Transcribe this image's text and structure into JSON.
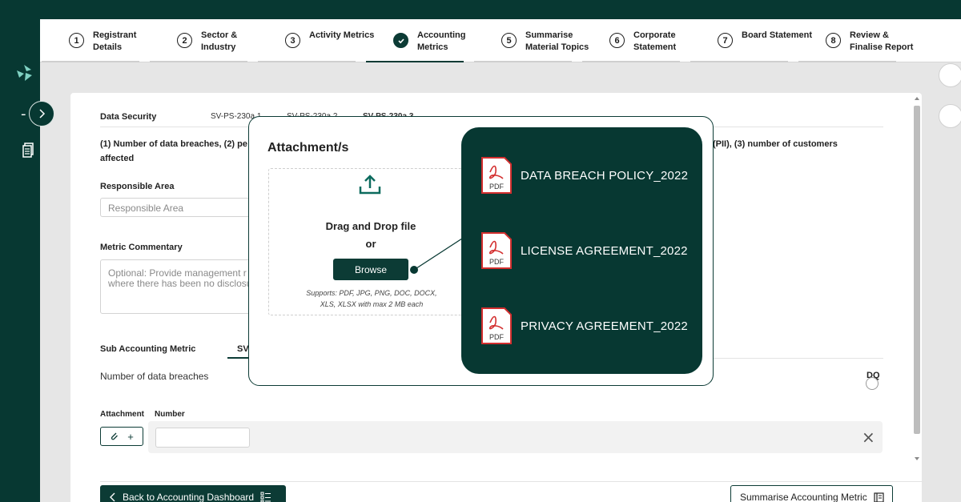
{
  "stepper": [
    {
      "num": "1",
      "label": "Registrant Details",
      "state": "pending"
    },
    {
      "num": "2",
      "label": "Sector & Industry",
      "state": "pending"
    },
    {
      "num": "3",
      "label": "Activity Metrics",
      "state": "pending"
    },
    {
      "num": "",
      "label": "Accounting Metrics",
      "state": "active"
    },
    {
      "num": "5",
      "label": "Summarise Material Topics",
      "state": "pending"
    },
    {
      "num": "6",
      "label": "Corporate Statement",
      "state": "pending"
    },
    {
      "num": "7",
      "label": "Board Statement",
      "state": "pending"
    },
    {
      "num": "8",
      "label": "Review & Finalise Report",
      "state": "pending"
    }
  ],
  "metric": {
    "topic": "Data Security",
    "codes": [
      "SV-PS-230a.1",
      "SV-PS-230a.2",
      "SV-PS-230a.3"
    ],
    "description_left": "(1) Number of data breaches, (2) pe",
    "description_right": "(PII), (3) number of customers",
    "description_line2": "affected"
  },
  "form": {
    "responsible_area_label": "Responsible Area",
    "responsible_area_placeholder": "Responsible Area",
    "commentary_label": "Metric Commentary",
    "commentary_placeholder": "Optional: Provide management r\nwhere there has been no disclosu",
    "sub_metric_label": "Sub Accounting Metric",
    "sub_metric_tab": "SV-",
    "sub_metric_item": "Number of data breaches",
    "dq_label": "DQ",
    "attachment_col": "Attachment",
    "number_col": "Number",
    "attach_plus": "+",
    "remove_icon": "×"
  },
  "footer": {
    "back_label": "Back to Accounting Dashboard",
    "summarise_label": "Summarise Accounting Metric"
  },
  "modal": {
    "title": "Attachment/s",
    "drop_line1": "Drag and Drop file",
    "drop_line2": "or",
    "browse_label": "Browse",
    "supports_line1": "Supports: PDF, JPG, PNG, DOC, DOCX,",
    "supports_line2": "XLS, XLSX with max 2 MB each"
  },
  "files": [
    {
      "name": "DATA BREACH POLICY_2022",
      "badge": "PDF"
    },
    {
      "name": "LICENSE AGREEMENT_2022",
      "badge": "PDF"
    },
    {
      "name": "PRIVACY AGREEMENT_2022",
      "badge": "PDF"
    }
  ],
  "colors": {
    "brand": "#073832",
    "accent": "#0c3b35",
    "pdf_red": "#d32f2f"
  }
}
